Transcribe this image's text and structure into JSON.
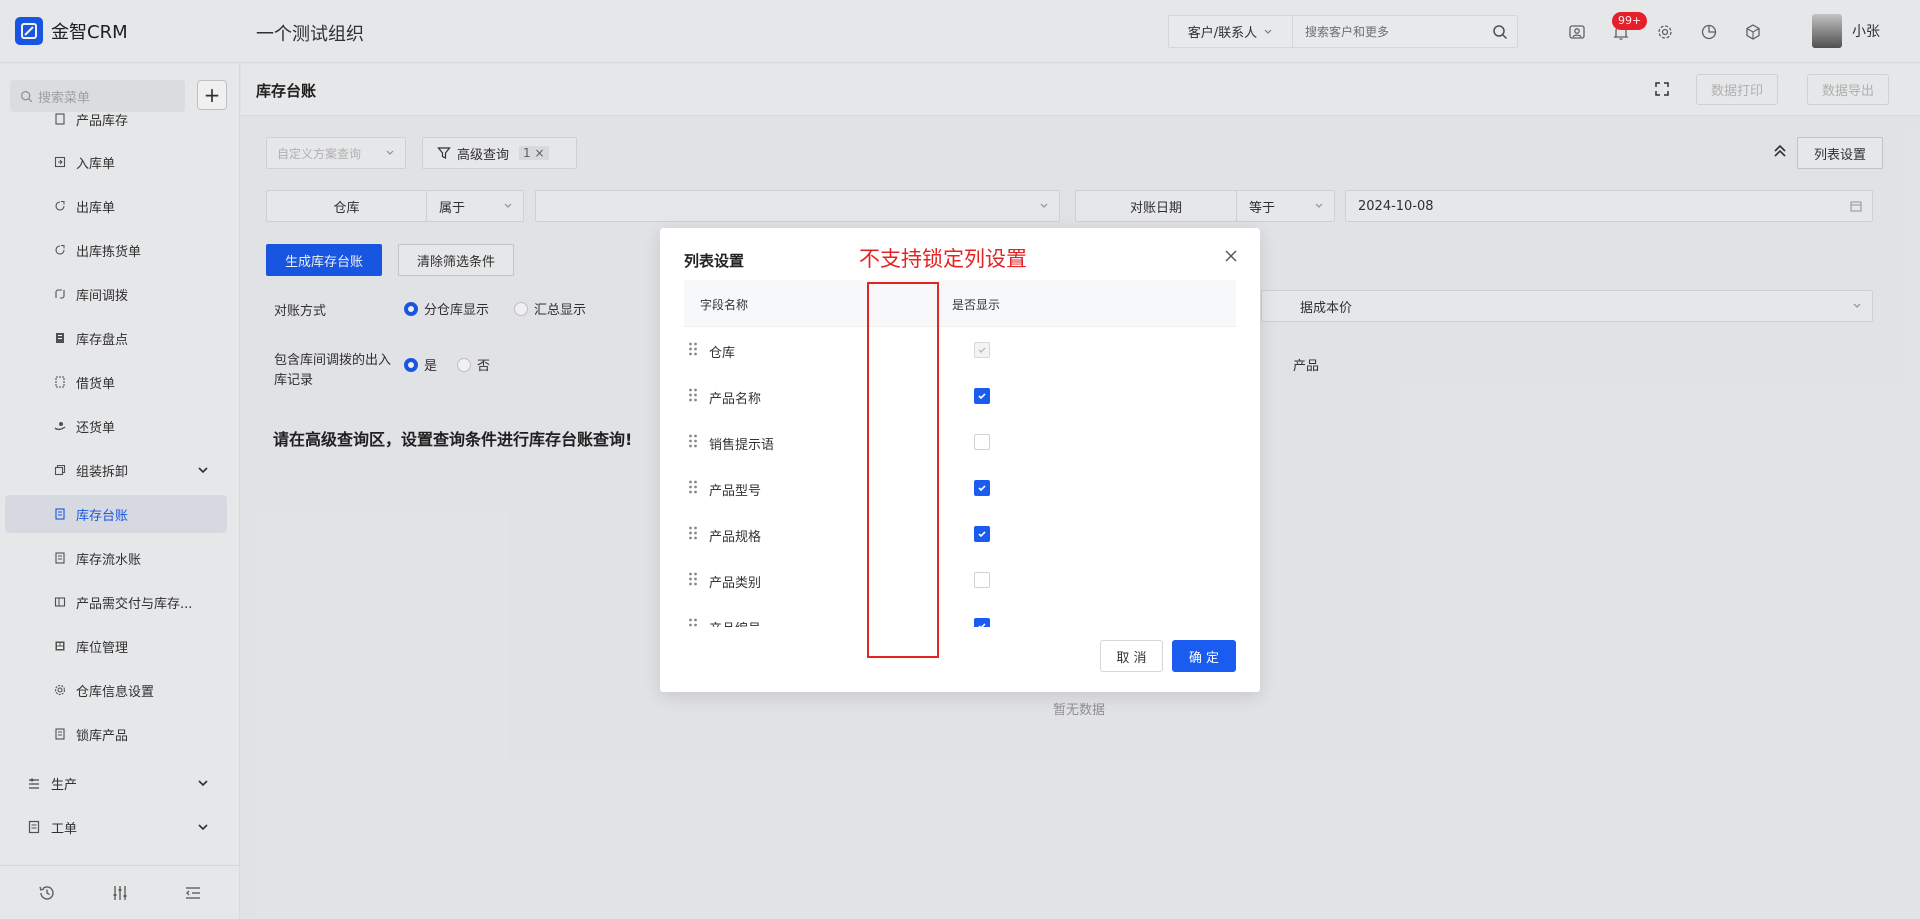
{
  "brand": {
    "name": "金智CRM"
  },
  "header": {
    "org_title": "一个测试组织",
    "search_scope": "客户/联系人",
    "search_placeholder": "搜索客户和更多",
    "notification_badge": "99+",
    "user_name": "小张"
  },
  "sidebar": {
    "search_placeholder": "搜索菜单",
    "items": [
      {
        "label": "产品库存",
        "icon": "doc-icon"
      },
      {
        "label": "入库单",
        "icon": "inbox-icon"
      },
      {
        "label": "出库单",
        "icon": "outbox-icon"
      },
      {
        "label": "出库拣货单",
        "icon": "pick-icon"
      },
      {
        "label": "库间调拨",
        "icon": "transfer-icon"
      },
      {
        "label": "库存盘点",
        "icon": "inventory-icon"
      },
      {
        "label": "借货单",
        "icon": "borrow-icon"
      },
      {
        "label": "还货单",
        "icon": "return-icon"
      },
      {
        "label": "组装拆卸",
        "icon": "assemble-icon"
      },
      {
        "label": "库存台账",
        "icon": "ledger-icon",
        "active": true
      },
      {
        "label": "库存流水账",
        "icon": "flow-icon"
      },
      {
        "label": "产品需交付与库存...",
        "icon": "delivery-icon"
      },
      {
        "label": "库位管理",
        "icon": "location-icon"
      },
      {
        "label": "仓库信息设置",
        "icon": "settings-icon"
      },
      {
        "label": "锁库产品",
        "icon": "lock-icon"
      }
    ],
    "groups": [
      {
        "label": "生产"
      },
      {
        "label": "工单"
      }
    ]
  },
  "page": {
    "title": "库存台账",
    "print_label": "数据打印",
    "export_label": "数据导出"
  },
  "filters": {
    "custom_scheme_placeholder": "自定义方案查询",
    "advanced_label": "高级查询",
    "advanced_count": "1",
    "column_settings_label": "列表设置",
    "warehouse_label": "仓库",
    "warehouse_op": "属于",
    "date_label": "对账日期",
    "date_op": "等于",
    "date_value": "2024-10-08",
    "generate_label": "生成库存台账",
    "clear_label": "清除筛选条件",
    "recon_label": "对账方式",
    "recon_opt1": "分仓库显示",
    "recon_opt2": "汇总显示",
    "cost_value_partial": "据成本价",
    "include_label": "包含库间调拨的出入库记录",
    "include_yes": "是",
    "include_no": "否",
    "product_partial": "产品"
  },
  "main": {
    "hint": "请在高级查询区，设置查询条件进行库存台账查询!",
    "empty": "暂无数据"
  },
  "modal": {
    "title": "列表设置",
    "annotation": "不支持锁定列设置",
    "col_field": "字段名称",
    "col_show": "是否显示",
    "rows": [
      {
        "name": "仓库",
        "state": "disabled"
      },
      {
        "name": "产品名称",
        "state": "checked"
      },
      {
        "name": "销售提示语",
        "state": "unchecked"
      },
      {
        "name": "产品型号",
        "state": "checked"
      },
      {
        "name": "产品规格",
        "state": "checked"
      },
      {
        "name": "产品类别",
        "state": "unchecked"
      },
      {
        "name": "产品编号",
        "state": "checked"
      }
    ],
    "cancel_label": "取 消",
    "ok_label": "确 定"
  },
  "colors": {
    "primary": "#1a5cf0",
    "annotation": "#e52323",
    "badge": "#f5222d"
  }
}
